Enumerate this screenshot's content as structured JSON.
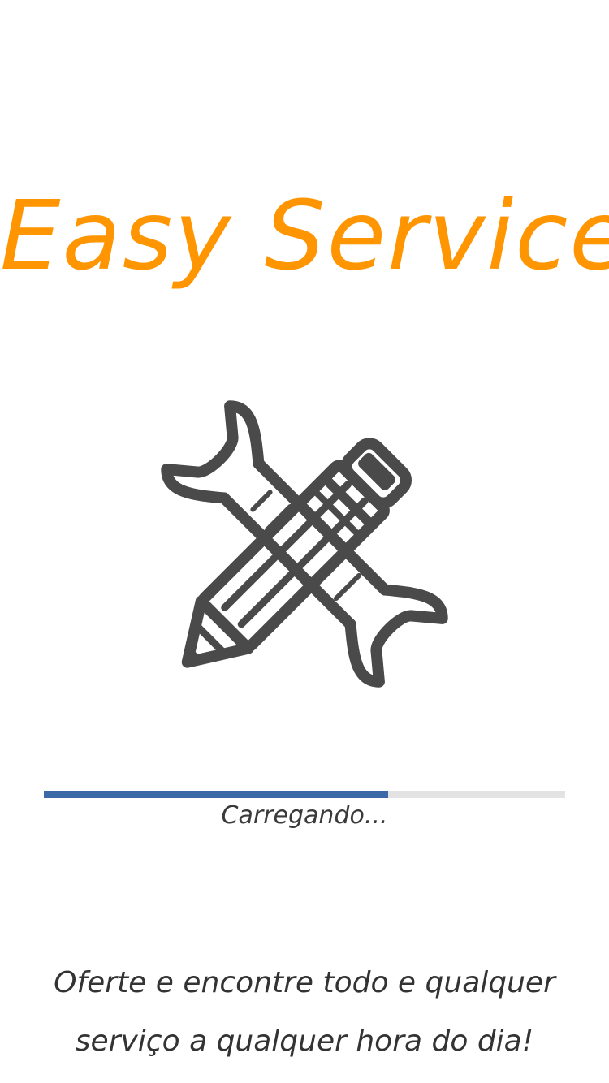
{
  "splash": {
    "title": "Easy Service",
    "logo_icon": "wrench-pencil-icon",
    "progress": 0.66,
    "loading_label": "Carregando...",
    "tagline": "Oferte e encontre todo e qualquer serviço a qualquer hora do dia!"
  },
  "colors": {
    "title": "#ff9500",
    "icon": "#4a4a4a",
    "progress_fill": "#3c6aa6",
    "progress_track": "#e3e3e3",
    "text": "#333333",
    "background": "#ffffff"
  }
}
